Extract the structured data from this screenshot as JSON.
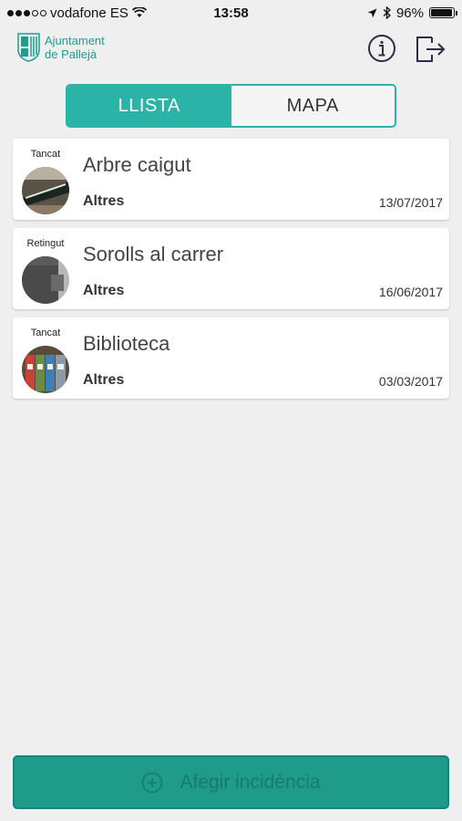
{
  "status_bar": {
    "carrier": "vodafone ES",
    "time": "13:58",
    "battery": "96%",
    "battery_level": 0.96
  },
  "header": {
    "logo_line1": "Ajuntament",
    "logo_line2": "de Pallejà"
  },
  "tabs": [
    {
      "label": "LLISTA",
      "active": true
    },
    {
      "label": "MAPA",
      "active": false
    }
  ],
  "incidents": [
    {
      "status": "Tancat",
      "title": "Arbre caigut",
      "category": "Altres",
      "date": "13/07/2017"
    },
    {
      "status": "Retingut",
      "title": "Sorolls al carrer",
      "category": "Altres",
      "date": "16/06/2017"
    },
    {
      "status": "Tancat",
      "title": "Biblioteca",
      "category": "Altres",
      "date": "03/03/2017"
    }
  ],
  "add_button": {
    "label": "Afegir incidència"
  },
  "colors": {
    "accent": "#2ab3a6",
    "button": "#1f9b8a"
  }
}
